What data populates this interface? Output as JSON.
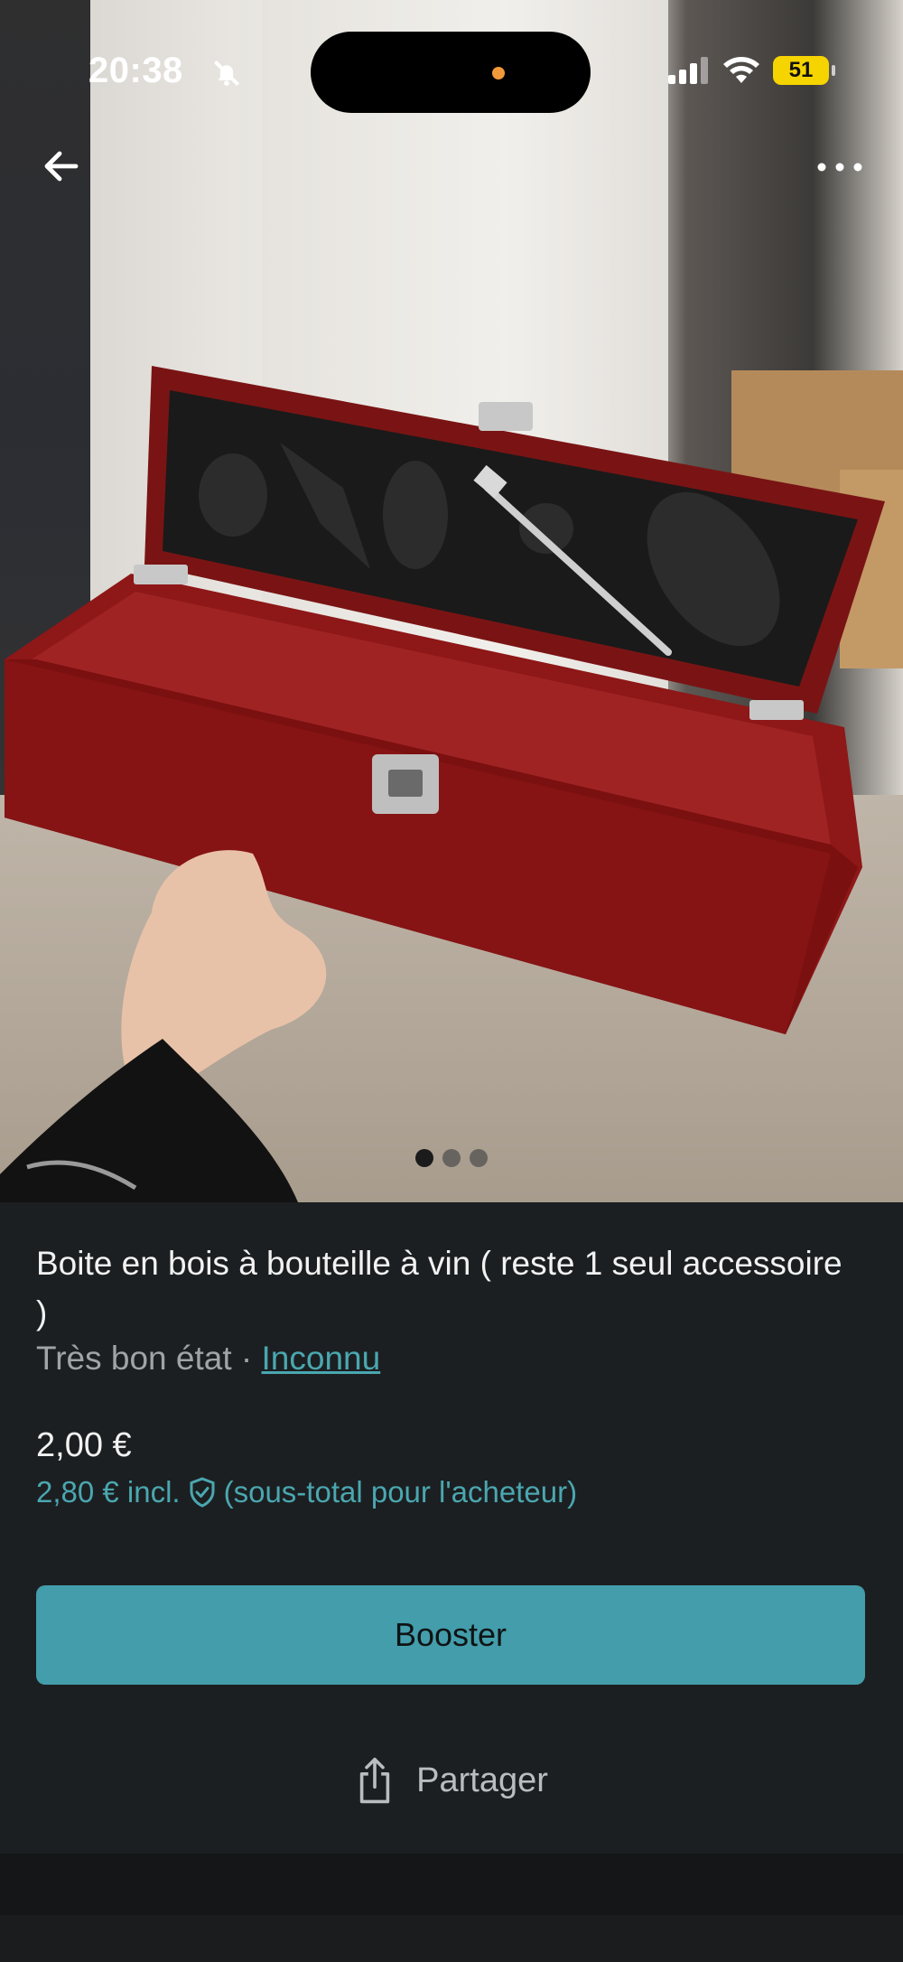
{
  "status_bar": {
    "time": "20:38",
    "battery": "51",
    "icons": [
      "bell-slash-icon",
      "signal-icon",
      "wifi-icon",
      "battery-icon"
    ]
  },
  "nav": {
    "back_icon": "arrow-left-icon",
    "more_icon": "more-horizontal-icon"
  },
  "gallery": {
    "image_count": 3,
    "active_index": 0
  },
  "listing": {
    "title": "Boite en bois à bouteille à vin ( reste 1 seul accessoire )",
    "condition": "Très bon état",
    "separator": " · ",
    "brand": "Inconnu",
    "price": "2,00 €",
    "price_incl": "2,80 € incl.",
    "price_incl_note": "(sous-total pour l'acheteur)"
  },
  "actions": {
    "boost_label": "Booster",
    "share_label": "Partager"
  },
  "colors": {
    "accent": "#439dab",
    "link": "#4aa7b0",
    "background": "#1c1f21"
  }
}
